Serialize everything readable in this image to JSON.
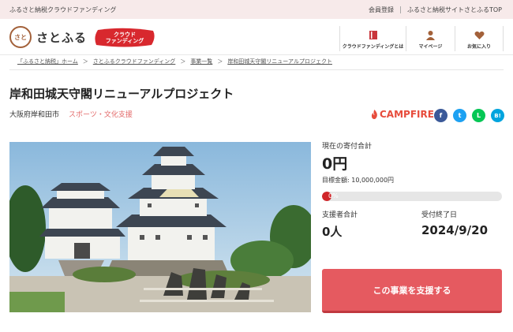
{
  "topbar": {
    "tagline": "ふるさと納税クラウドファンディング",
    "links": [
      "会員登録",
      "ふるさと納税サイトさとふるTOP"
    ]
  },
  "header": {
    "logo_mark": "さと",
    "logo_text": "さとふる",
    "badge_line1": "クラウド",
    "badge_line2": "ファンディング",
    "nav": [
      {
        "label": "クラウドファンディングとは",
        "icon": "book-icon"
      },
      {
        "label": "マイページ",
        "icon": "person-icon"
      },
      {
        "label": "お気に入り",
        "icon": "heart-icon"
      }
    ]
  },
  "breadcrumb": [
    "「ふるさと納税」ホーム",
    "さとふるクラウドファンディング",
    "事業一覧",
    "岸和田城天守閣リニューアルプロジェクト"
  ],
  "breadcrumb_separator": "＞",
  "project": {
    "title": "岸和田城天守閣リニューアルプロジェクト",
    "location": "大阪府岸和田市",
    "category": "スポーツ・文化支援"
  },
  "partner": {
    "name": "CAMPFIRE"
  },
  "social": [
    {
      "icon": "facebook-icon",
      "glyph": "f",
      "color": "#3b5998"
    },
    {
      "icon": "twitter-icon",
      "glyph": "t",
      "color": "#1da1f2"
    },
    {
      "icon": "line-icon",
      "glyph": "L",
      "color": "#06c755"
    },
    {
      "icon": "hatena-icon",
      "glyph": "B!",
      "color": "#00a4de"
    }
  ],
  "stats": {
    "current_label": "現在の寄付合計",
    "current_value": "0円",
    "goal_text": "目標金額: 10,000,000円",
    "progress_text": "0%",
    "progress_fraction": 0,
    "supporters_label": "支援者合計",
    "supporters_value": "0人",
    "deadline_label": "受付終了日",
    "deadline_value": "2024/9/20"
  },
  "cta": {
    "label": "この事業を支援する"
  },
  "colors": {
    "accent": "#e55a60",
    "brand_red": "#d0262a",
    "topbar_bg": "#f7eaea"
  }
}
